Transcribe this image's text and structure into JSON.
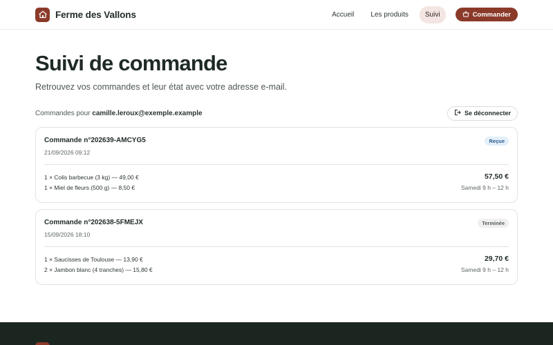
{
  "header": {
    "brand_name": "Ferme des Vallons",
    "nav": [
      {
        "label": "Accueil",
        "active": false
      },
      {
        "label": "Les produits",
        "active": false
      },
      {
        "label": "Suivi",
        "active": true
      }
    ],
    "order_button": "Commander"
  },
  "page": {
    "title": "Suivi de commande",
    "subtitle": "Retrouvez vos commandes et leur état avec votre adresse e-mail.",
    "account_prefix": "Commandes pour",
    "account_email": "camille.leroux@exemple.example",
    "logout_label": "Se déconnecter"
  },
  "orders": [
    {
      "number": "Commande n°202639-AMCYG5",
      "date": "21/09/2026 09:12",
      "status": "Reçue",
      "items": [
        "1 × Colis barbecue (3 kg) — 49,00 €",
        "1 × Miel de fleurs (500 g) — 8,50 €"
      ],
      "total": "57,50 €",
      "slot": "Samedi 9 h – 12 h"
    },
    {
      "number": "Commande n°202638-5FMEJX",
      "date": "15/09/2026 18:10",
      "status": "Terminée",
      "items": [
        "1 × Saucisses de Toulouse — 13,90 €",
        "2 × Jambon blanc (4 tranches) — 15,80 €"
      ],
      "total": "29,70 €",
      "slot": "Samedi 9 h – 12 h"
    }
  ],
  "colors": {
    "brand": "#8b3a2a",
    "footer": "#1c2621",
    "active_nav_bg": "#f3e6e2",
    "status_received_bg": "#e3effa",
    "status_done_bg": "#efefef"
  },
  "icons": {
    "brand": "house-icon",
    "order_button": "basket-icon",
    "logout": "logout-icon"
  }
}
